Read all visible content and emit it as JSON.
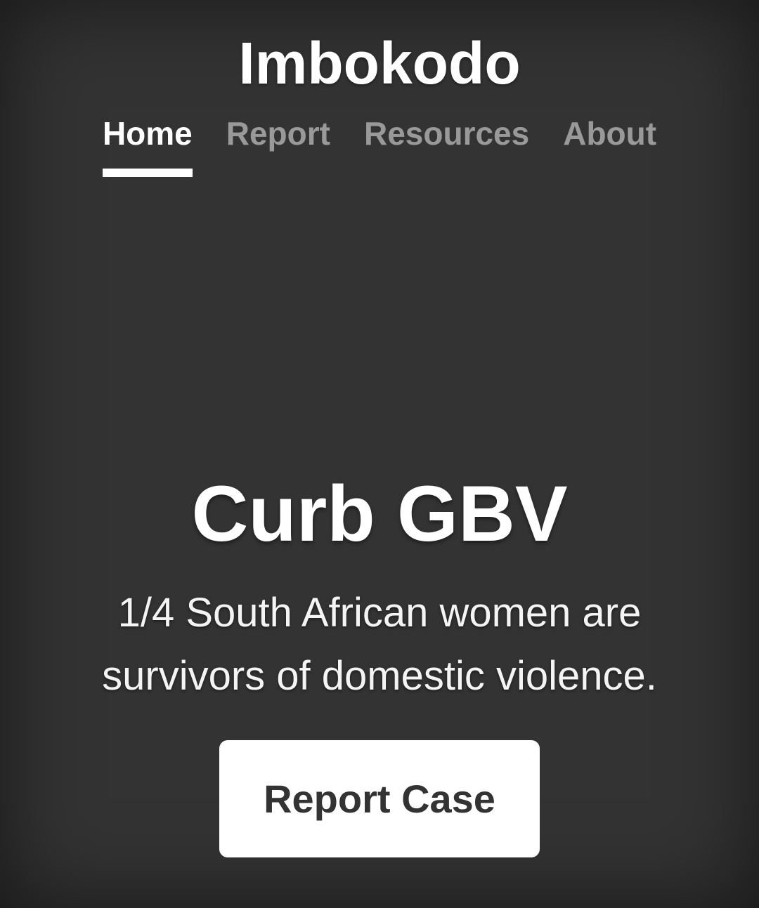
{
  "header": {
    "brand": "Imbokodo"
  },
  "nav": {
    "items": [
      {
        "label": "Home",
        "active": true
      },
      {
        "label": "Report",
        "active": false
      },
      {
        "label": "Resources",
        "active": false
      },
      {
        "label": "About",
        "active": false
      }
    ]
  },
  "hero": {
    "title": "Curb GBV",
    "text": "1/4 South African women are survivors of domestic violence.",
    "cta_label": "Report Case"
  },
  "colors": {
    "background": "#333333",
    "text": "#ffffff",
    "nav_inactive": "#999999",
    "button_bg": "#ffffff",
    "button_text": "#333333"
  }
}
